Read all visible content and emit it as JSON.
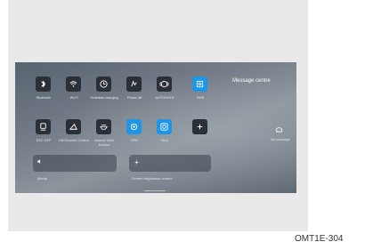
{
  "tiles": [
    {
      "label": "Bluetooth",
      "icon": "bluetooth-icon",
      "active": false
    },
    {
      "label": "Wi-Fi",
      "icon": "wifi-icon",
      "active": false
    },
    {
      "label": "Schedule charging",
      "icon": "clock-icon",
      "active": false
    },
    {
      "label": "Power off",
      "icon": "power-off-icon",
      "active": false
    },
    {
      "label": "AUTOHOLD",
      "icon": "autohold-icon",
      "active": false
    },
    {
      "label": "DMS",
      "icon": "dms-icon",
      "active": true
    },
    {
      "label": "ESC OFF",
      "icon": "esc-off-icon",
      "active": false
    },
    {
      "label": "Hill Descent Control",
      "icon": "hill-descent-icon",
      "active": false
    },
    {
      "label": "Around View Monitor",
      "icon": "avm-icon",
      "active": false
    },
    {
      "label": "EPB",
      "icon": "epb-icon",
      "active": true
    },
    {
      "label": "RLA",
      "icon": "rla-icon",
      "active": true
    },
    {
      "label": "",
      "icon": "plus-icon",
      "active": false
    }
  ],
  "media": {
    "label": "Media",
    "icon": "speaker-icon"
  },
  "brightness": {
    "label": "Screen brightness control",
    "icon": "sun-icon"
  },
  "message_centre": {
    "title": "Message centre",
    "empty_text": "No message",
    "icon": "message-icon"
  },
  "figure_code": "OMT1E-304",
  "colors": {
    "accent": "#1f95e6",
    "tile": "#2b3038"
  }
}
